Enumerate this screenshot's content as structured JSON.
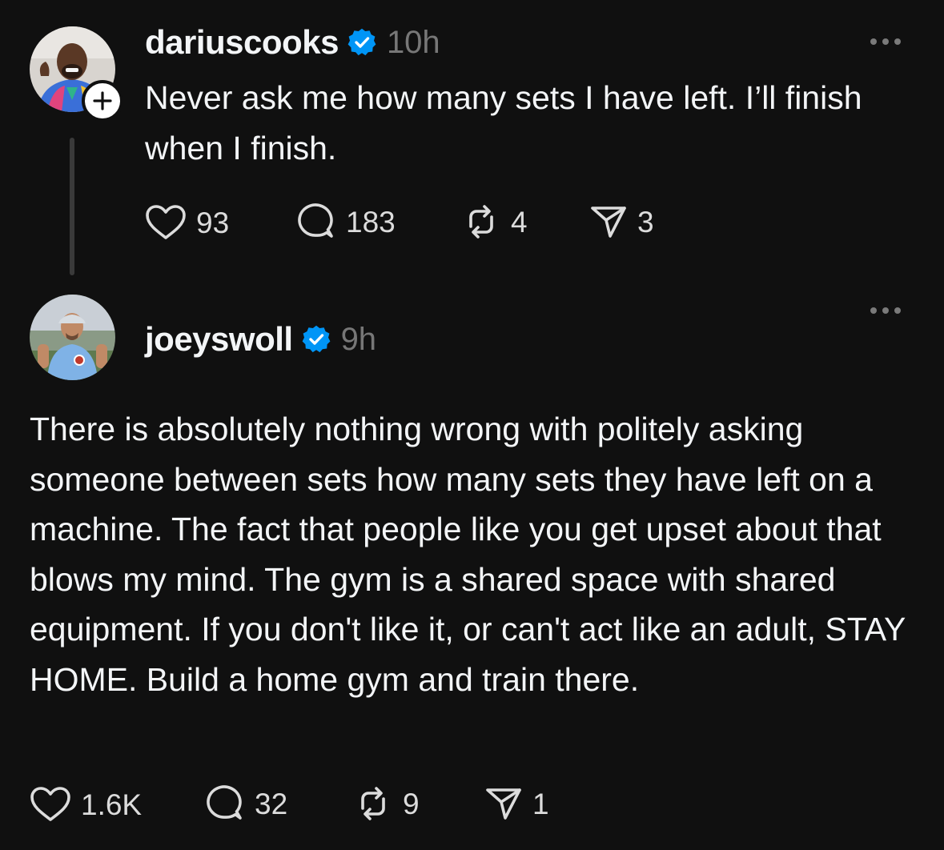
{
  "posts": [
    {
      "username": "dariuscooks",
      "time": "10h",
      "text": "Never ask me how many sets I have left. I’ll finish when I finish.",
      "likes": "93",
      "replies": "183",
      "reposts": "4",
      "shares": "3"
    },
    {
      "username": "joeyswoll",
      "time": "9h",
      "text": "There is absolutely nothing wrong with politely asking someone between sets how many sets they have left on a machine. The fact that people like you get upset about that blows my mind. The gym is a shared space with shared equipment. If you don't like it, or can't act like an adult, STAY HOME. Build a home gym and train there.",
      "likes": "1.6K",
      "replies": "32",
      "reposts": "9",
      "shares": "1"
    }
  ],
  "colors": {
    "background": "#101010",
    "text": "#f3f5f7",
    "muted": "#777777",
    "verified": "#0095f6"
  },
  "icons": [
    "heart-icon",
    "comment-icon",
    "repost-icon",
    "share-icon",
    "verified-badge-icon",
    "more-options-icon",
    "follow-plus-icon"
  ]
}
